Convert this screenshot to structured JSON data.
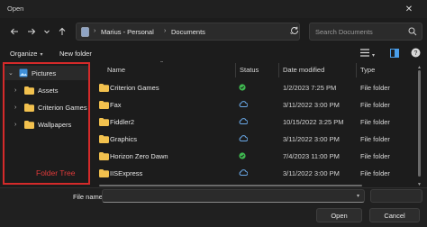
{
  "window": {
    "title": "Open",
    "close_glyph": "✕"
  },
  "nav": {
    "back_icon": "arrow-left-icon",
    "forward_icon": "arrow-right-icon",
    "recent_icon": "chevron-down-icon",
    "up_icon": "arrow-up-icon"
  },
  "address": {
    "root": "Marius - Personal",
    "current": "Documents"
  },
  "search": {
    "placeholder": "Search Documents"
  },
  "toolbar": {
    "organize": "Organize",
    "new_folder": "New folder"
  },
  "tree": {
    "items": [
      {
        "label": "Pictures",
        "expanded": true,
        "selected": true
      },
      {
        "label": "Assets"
      },
      {
        "label": "Criterion Games"
      },
      {
        "label": "Wallpapers"
      }
    ],
    "annotation": "Folder Tree",
    "annotation_color": "#d42a2a"
  },
  "columns": {
    "name": "Name",
    "status": "Status",
    "date": "Date modified",
    "type": "Type"
  },
  "files": [
    {
      "name": "Criterion Games",
      "status": "synced",
      "date": "1/2/2023 7:25 PM",
      "type": "File folder"
    },
    {
      "name": "Fax",
      "status": "cloud",
      "date": "3/11/2022 3:00 PM",
      "type": "File folder"
    },
    {
      "name": "Fiddler2",
      "status": "cloud",
      "date": "10/15/2022 3:25 PM",
      "type": "File folder"
    },
    {
      "name": "Graphics",
      "status": "cloud",
      "date": "3/11/2022 3:00 PM",
      "type": "File folder"
    },
    {
      "name": "Horizon Zero Dawn",
      "status": "synced",
      "date": "7/4/2023 11:00 PM",
      "type": "File folder"
    },
    {
      "name": "IISExpress",
      "status": "cloud",
      "date": "3/11/2022 3:00 PM",
      "type": "File folder"
    }
  ],
  "bottom": {
    "file_name_label": "File name:",
    "file_name_value": "",
    "open": "Open",
    "cancel": "Cancel"
  },
  "colors": {
    "accent": "#0078d4",
    "folder": "#f2c14e",
    "synced": "#3fb950",
    "cloud": "#6aa9e8"
  }
}
